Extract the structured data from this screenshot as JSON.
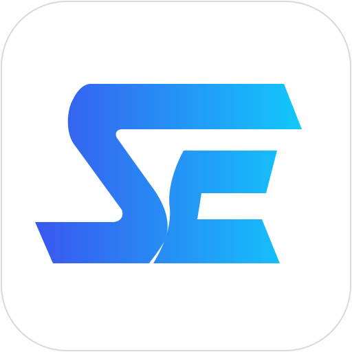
{
  "app_icon": {
    "logo": {
      "lettering": "SE",
      "icon": "se-monogram-icon",
      "gradient_start": "#3a56ef",
      "gradient_end": "#12c8fb"
    },
    "border_color": "#d9d9d9",
    "background": "#ffffff"
  }
}
